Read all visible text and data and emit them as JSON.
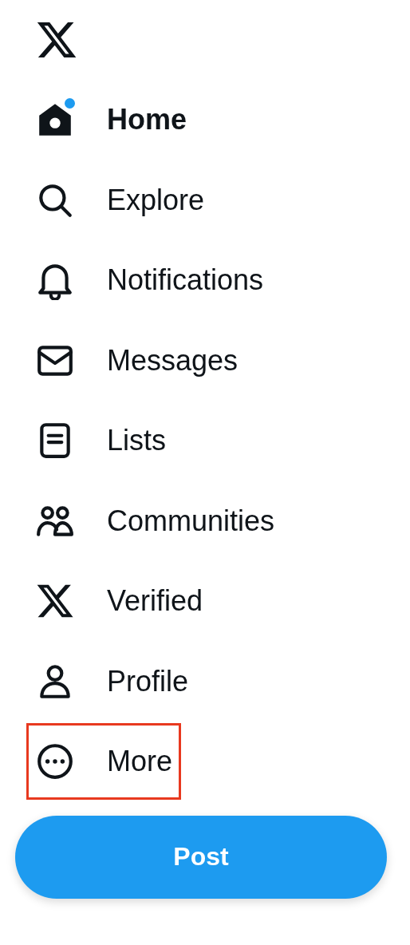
{
  "nav": [
    {
      "label": "Home",
      "selected": true,
      "unread": true,
      "highlighted": false
    },
    {
      "label": "Explore",
      "selected": false,
      "unread": false,
      "highlighted": false
    },
    {
      "label": "Notifications",
      "selected": false,
      "unread": false,
      "highlighted": false
    },
    {
      "label": "Messages",
      "selected": false,
      "unread": false,
      "highlighted": false
    },
    {
      "label": "Lists",
      "selected": false,
      "unread": false,
      "highlighted": false
    },
    {
      "label": "Communities",
      "selected": false,
      "unread": false,
      "highlighted": false
    },
    {
      "label": "Verified",
      "selected": false,
      "unread": false,
      "highlighted": false
    },
    {
      "label": "Profile",
      "selected": false,
      "unread": false,
      "highlighted": false
    },
    {
      "label": "More",
      "selected": false,
      "unread": false,
      "highlighted": true
    }
  ],
  "post_button": "Post"
}
